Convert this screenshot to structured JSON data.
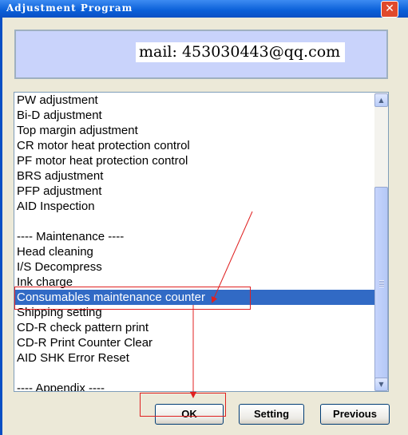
{
  "window": {
    "title": "Adjustment Program",
    "close_glyph": "✕"
  },
  "banner": {
    "text": "mail: 453030443@qq.com"
  },
  "list": {
    "items": [
      "PW adjustment",
      "Bi-D adjustment",
      "Top margin adjustment",
      "CR motor heat protection control",
      "PF motor heat protection control",
      "BRS adjustment",
      "PFP adjustment",
      "AID Inspection",
      "",
      "---- Maintenance ----",
      "Head cleaning",
      "I/S Decompress",
      "Ink charge",
      "Consumables maintenance counter",
      "Shipping setting",
      "CD-R check pattern print",
      "CD-R Print Counter Clear",
      "AID SHK Error Reset",
      "",
      "---- Appendix ----"
    ],
    "selected_index": 13,
    "selected_color": "#316ac5"
  },
  "scrollbar": {
    "up_icon": "▲",
    "down_icon": "▼"
  },
  "buttons": {
    "ok": "OK",
    "setting": "Setting",
    "previous": "Previous"
  },
  "annotation_color": "#e02020"
}
